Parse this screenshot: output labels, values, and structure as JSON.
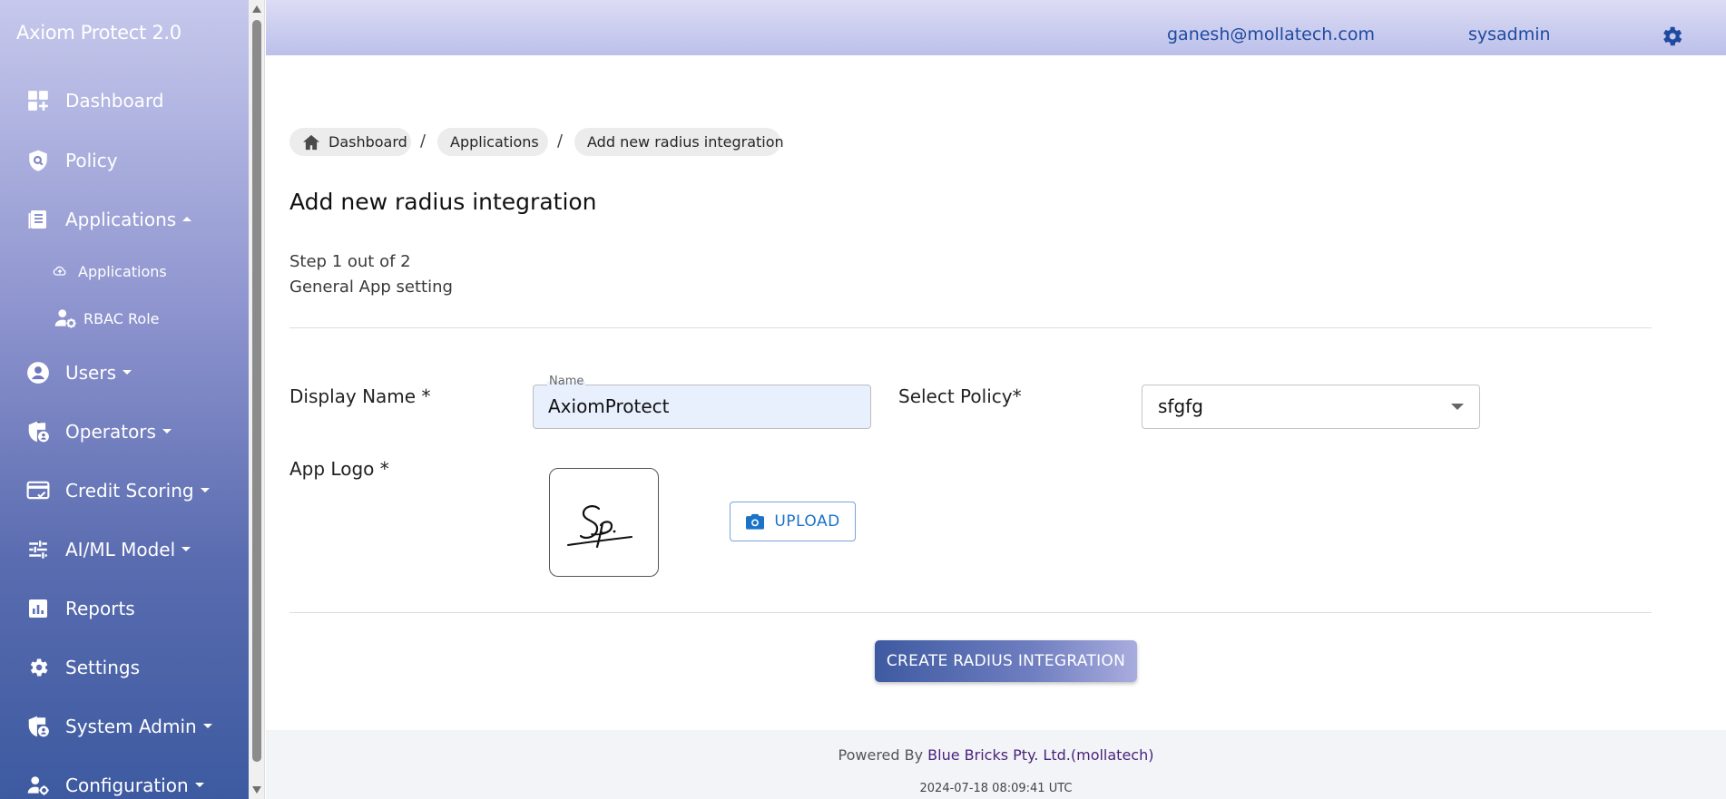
{
  "app": {
    "title": "Axiom Protect 2.0"
  },
  "sidebar": {
    "items": [
      {
        "label": "Dashboard",
        "icon": "dashboard-icon"
      },
      {
        "label": "Policy",
        "icon": "shield-search-icon"
      },
      {
        "label": "Applications",
        "icon": "document-list-icon",
        "expanded": true
      },
      {
        "label": "Users",
        "icon": "user-circle-icon"
      },
      {
        "label": "Operators",
        "icon": "shield-user-icon"
      },
      {
        "label": "Credit Scoring",
        "icon": "credit-card-check-icon"
      },
      {
        "label": "AI/ML Model",
        "icon": "sliders-icon"
      },
      {
        "label": "Reports",
        "icon": "bar-chart-icon"
      },
      {
        "label": "Settings",
        "icon": "gear-icon"
      },
      {
        "label": "System Admin",
        "icon": "shield-user-icon"
      },
      {
        "label": "Configuration",
        "icon": "user-gear-icon"
      }
    ],
    "subitems": [
      {
        "label": "Applications",
        "icon": "cloud-upload-icon"
      },
      {
        "label": "RBAC Role",
        "icon": "user-gear-icon"
      }
    ]
  },
  "topbar": {
    "email": "ganesh@mollatech.com",
    "user": "sysadmin",
    "settings_icon": "gear-icon"
  },
  "breadcrumb": [
    "Dashboard",
    "Applications",
    "Add new radius integration"
  ],
  "breadcrumb_separator": "/",
  "page": {
    "title": "Add new radius integration",
    "step": "Step 1 out of 2",
    "step_name": "General App setting"
  },
  "form": {
    "display_name_label": "Display Name *",
    "name_legend": "Name",
    "name_value": "AxiomProtect",
    "policy_label": "Select Policy*",
    "policy_value": "sfgfg",
    "logo_label": "App Logo *",
    "upload_label": "UPLOAD",
    "submit_label": "CREATE RADIUS INTEGRATION"
  },
  "footer": {
    "powered_prefix": "Powered By",
    "company": "Blue Bricks Pty. Ltd.(mollatech)",
    "timestamp": "2024-07-18 08:09:41 UTC"
  },
  "colors": {
    "accent": "#1f4aa0",
    "sidebar_top": "#c6c8ec",
    "sidebar_bottom": "#3d5aa0",
    "button": "#3e5aa1"
  }
}
